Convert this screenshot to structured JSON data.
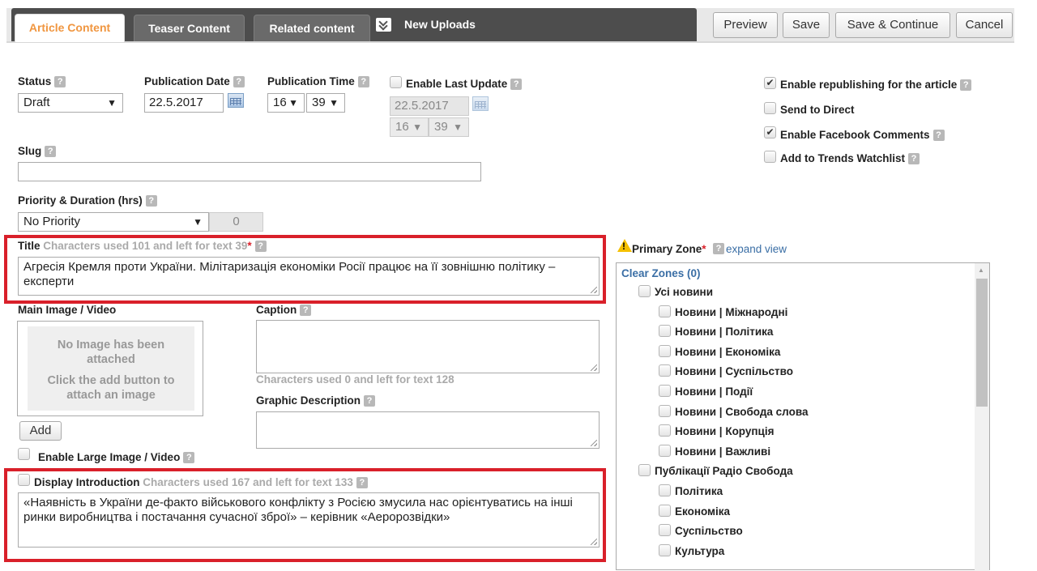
{
  "tabs": {
    "article_content": "Article Content",
    "teaser_content": "Teaser Content",
    "related_content": "Related content",
    "new_uploads": "New Uploads"
  },
  "toolbar": {
    "preview": "Preview",
    "save": "Save",
    "save_continue": "Save & Continue",
    "cancel": "Cancel"
  },
  "status": {
    "label": "Status",
    "value": "Draft"
  },
  "publication_date": {
    "label": "Publication Date",
    "value": "22.5.2017"
  },
  "publication_time": {
    "label": "Publication Time",
    "hour": "16",
    "minute": "39"
  },
  "last_update": {
    "label": "Enable Last Update",
    "date": "22.5.2017",
    "hour": "16",
    "minute": "39",
    "checked": false
  },
  "options": {
    "republishing": {
      "label": "Enable republishing for the article",
      "checked": true
    },
    "send_direct": {
      "label": "Send to Direct",
      "checked": false
    },
    "facebook_comments": {
      "label": "Enable Facebook Comments",
      "checked": true
    },
    "trends_watchlist": {
      "label": "Add to Trends Watchlist",
      "checked": false
    }
  },
  "slug": {
    "label": "Slug",
    "value": ""
  },
  "priority": {
    "label": "Priority & Duration (hrs)",
    "value": "No Priority",
    "duration": "0"
  },
  "title": {
    "label": "Title",
    "hint": "Characters used 101 and left for text 39",
    "required_mark": "*",
    "value": "Агресія Кремля проти України. Мілітаризація економіки Росії працює на її зовнішню політику – експерти"
  },
  "main_image": {
    "label": "Main Image / Video",
    "empty_line1": "No Image has been attached",
    "empty_line2": "Click the add button to attach an image",
    "add_button": "Add",
    "large_label": "Enable Large Image / Video"
  },
  "caption": {
    "label": "Caption",
    "value": "",
    "hint": "Characters used 0 and left for text 128"
  },
  "graphic_description": {
    "label": "Graphic Description",
    "value": ""
  },
  "introduction": {
    "label": "Display Introduction",
    "hint": "Characters used 167 and left for text 133",
    "value": "«Наявність в України де-факто військового конфлікту з Росією змусила нас орієнтуватись на інші ринки виробництва і постачання сучасної зброї» – керівник «Аеророзвідки»",
    "checked": false
  },
  "primary_zone": {
    "label": "Primary Zone",
    "required_mark": "*",
    "expand": "expand view",
    "clear": "Clear Zones (0)",
    "items": [
      {
        "label": "Усі новини",
        "level": 0
      },
      {
        "label": "Новини | Міжнародні",
        "level": 1
      },
      {
        "label": "Новини | Політика",
        "level": 1
      },
      {
        "label": "Новини | Економіка",
        "level": 1
      },
      {
        "label": "Новини | Суспільство",
        "level": 1
      },
      {
        "label": "Новини | Події",
        "level": 1
      },
      {
        "label": "Новини | Свобода слова",
        "level": 1
      },
      {
        "label": "Новини | Корупція",
        "level": 1
      },
      {
        "label": "Новини | Важливі",
        "level": 1
      },
      {
        "label": "Публікації Радіо Свобода",
        "level": 0
      },
      {
        "label": "Політика",
        "level": 1
      },
      {
        "label": "Економіка",
        "level": 1
      },
      {
        "label": "Суспільство",
        "level": 1
      },
      {
        "label": "Культура",
        "level": 1
      }
    ]
  },
  "colors": {
    "active_tab": "#f09640",
    "highlight": "#d9202a",
    "link": "#3a6ea5"
  }
}
